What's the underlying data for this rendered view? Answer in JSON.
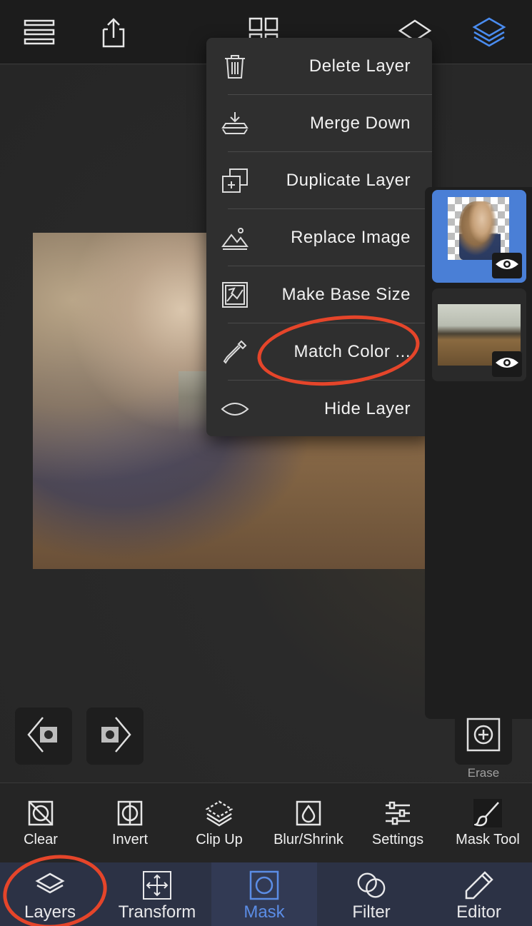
{
  "top_bar": {
    "icons": [
      "list-icon",
      "share-icon",
      "grid-icon",
      "layer-outline-icon",
      "layers-stack-icon"
    ],
    "accent": "#4a8cf0"
  },
  "context_menu": {
    "items": [
      {
        "label": "Delete Layer",
        "icon": "trash-icon"
      },
      {
        "label": "Merge Down",
        "icon": "merge-down-icon"
      },
      {
        "label": "Duplicate Layer",
        "icon": "duplicate-icon"
      },
      {
        "label": "Replace Image",
        "icon": "replace-image-icon"
      },
      {
        "label": "Make Base Size",
        "icon": "base-size-icon"
      },
      {
        "label": "Match Color ...",
        "icon": "eyedropper-icon"
      },
      {
        "label": "Hide Layer",
        "icon": "eye-outline-icon"
      }
    ],
    "highlighted_item": "Match Color ...",
    "annotation_color": "#e5452a"
  },
  "layers_panel": {
    "layers": [
      {
        "name": "girl-cutout",
        "selected": true,
        "visible": true
      },
      {
        "name": "beach-background",
        "selected": false,
        "visible": true
      }
    ],
    "selected_color": "#4a7fd6"
  },
  "canvas_nav": {
    "add_button_label": "Erase"
  },
  "tools": [
    {
      "label": "Clear",
      "icon": "clear-icon"
    },
    {
      "label": "Invert",
      "icon": "invert-icon"
    },
    {
      "label": "Clip Up",
      "icon": "clip-up-icon"
    },
    {
      "label": "Blur/Shrink",
      "icon": "blur-icon"
    },
    {
      "label": "Settings",
      "icon": "sliders-icon"
    },
    {
      "label": "Mask Tool",
      "icon": "brush-icon"
    }
  ],
  "tabs": [
    {
      "label": "Layers",
      "icon": "layers-tab-icon",
      "active": false
    },
    {
      "label": "Transform",
      "icon": "transform-icon",
      "active": false
    },
    {
      "label": "Mask",
      "icon": "mask-icon",
      "active": true
    },
    {
      "label": "Filter",
      "icon": "filter-icon",
      "active": false
    },
    {
      "label": "Editor",
      "icon": "pencil-icon",
      "active": false
    }
  ]
}
